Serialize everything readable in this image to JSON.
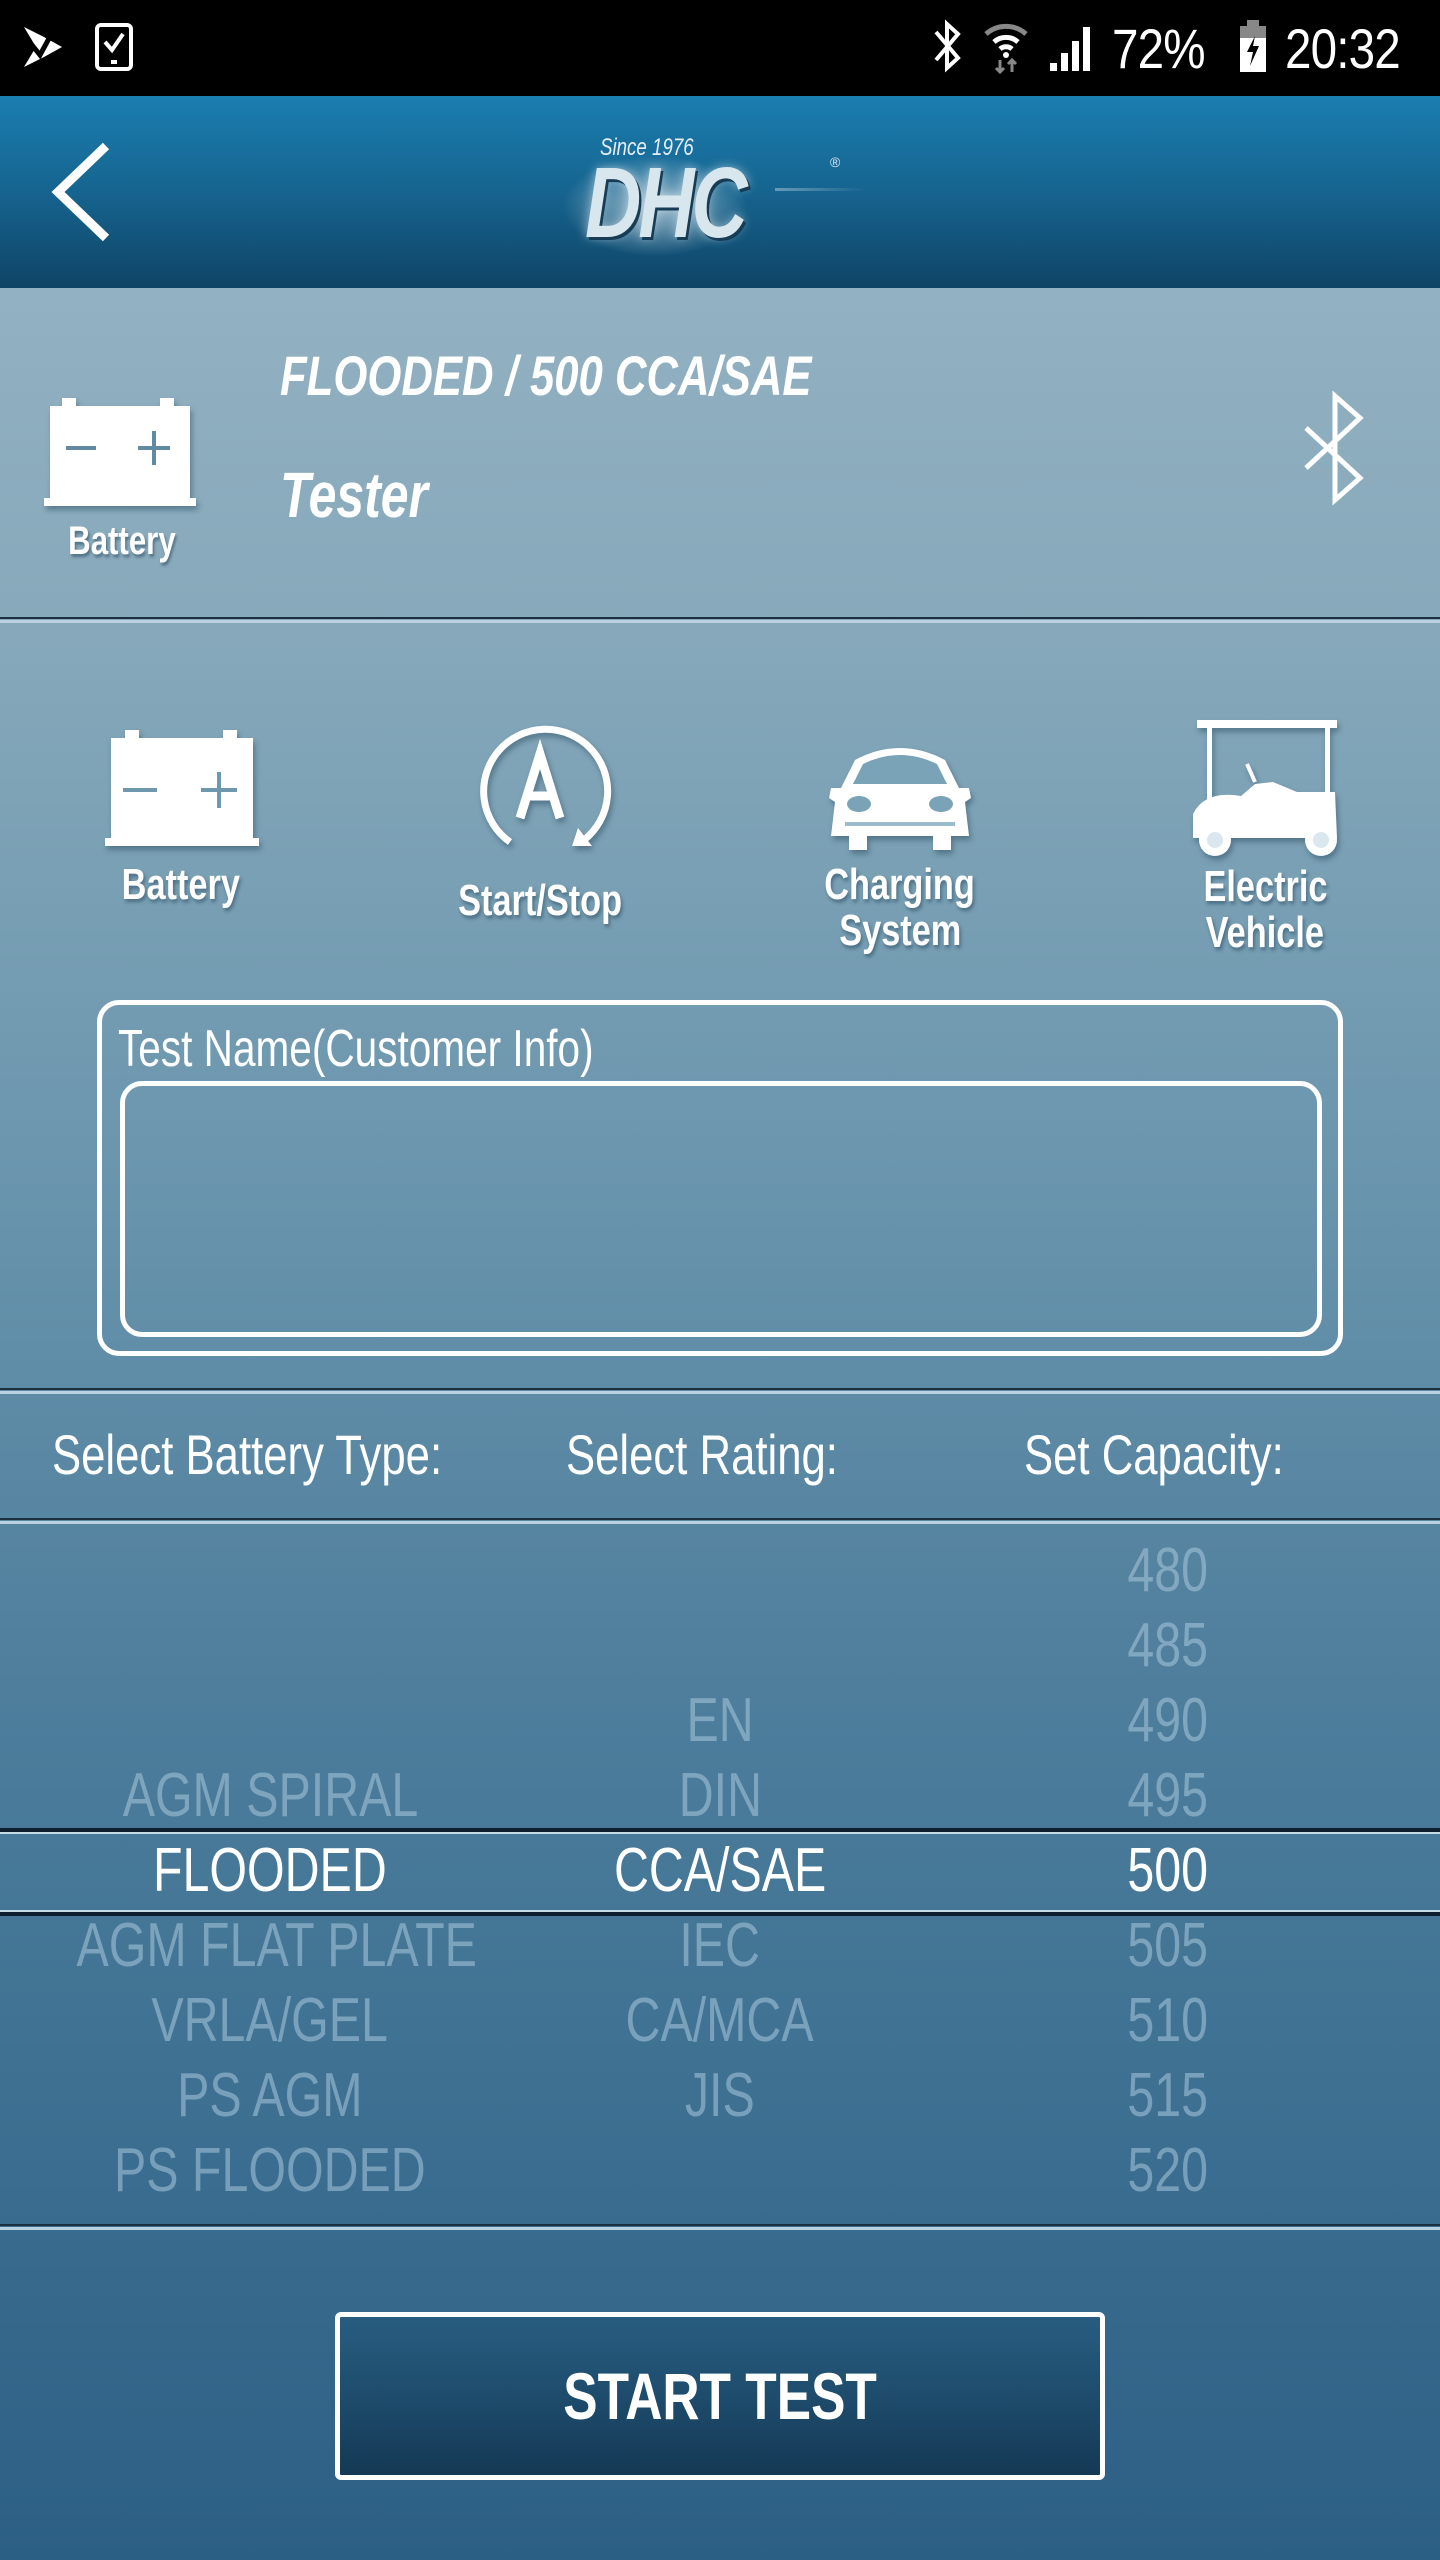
{
  "status_bar": {
    "left_icons": [
      "notification-app-icon",
      "task-check-icon"
    ],
    "right_icons": [
      "bluetooth-icon",
      "wifi-icon",
      "signal-icon"
    ],
    "battery_percent": "72%",
    "battery_icon": "battery-charging-icon",
    "time": "20:32"
  },
  "header": {
    "back_icon": "chevron-left-icon",
    "logo_tagline": "Since 1976",
    "logo_text": "DHC",
    "logo_registered": "®"
  },
  "info": {
    "device_icon_label": "Battery",
    "summary": "FLOODED / 500 CCA/SAE",
    "mode": "Tester",
    "bluetooth_icon": "bluetooth-icon"
  },
  "categories": [
    {
      "label": "Battery",
      "icon": "battery-icon"
    },
    {
      "label": "Start/Stop",
      "icon": "start-stop-icon"
    },
    {
      "label_line1": "Charging",
      "label_line2": "System",
      "icon": "car-icon"
    },
    {
      "label_line1": "Electric",
      "label_line2": "Vehicle",
      "icon": "golf-cart-icon"
    }
  ],
  "test_name": {
    "label": "Test Name(Customer Info)",
    "value": "",
    "placeholder": ""
  },
  "columns": {
    "battery_type": "Select Battery Type:",
    "rating": "Select Rating:",
    "capacity": "Set Capacity:"
  },
  "pickers": {
    "battery_type": {
      "items": [
        "",
        "",
        "",
        "AGM SPIRAL",
        "FLOODED",
        "AGM FLAT PLATE",
        "VRLA/GEL",
        "PS AGM",
        "PS FLOODED"
      ],
      "selected": "FLOODED"
    },
    "rating": {
      "items": [
        "",
        "",
        "EN",
        "DIN",
        "CCA/SAE",
        "IEC",
        "CA/MCA",
        "JIS",
        ""
      ],
      "selected": "CCA/SAE"
    },
    "capacity": {
      "items": [
        "480",
        "485",
        "490",
        "495",
        "500",
        "505",
        "510",
        "515",
        "520"
      ],
      "selected": "500"
    }
  },
  "start_button": {
    "label": "START TEST"
  }
}
